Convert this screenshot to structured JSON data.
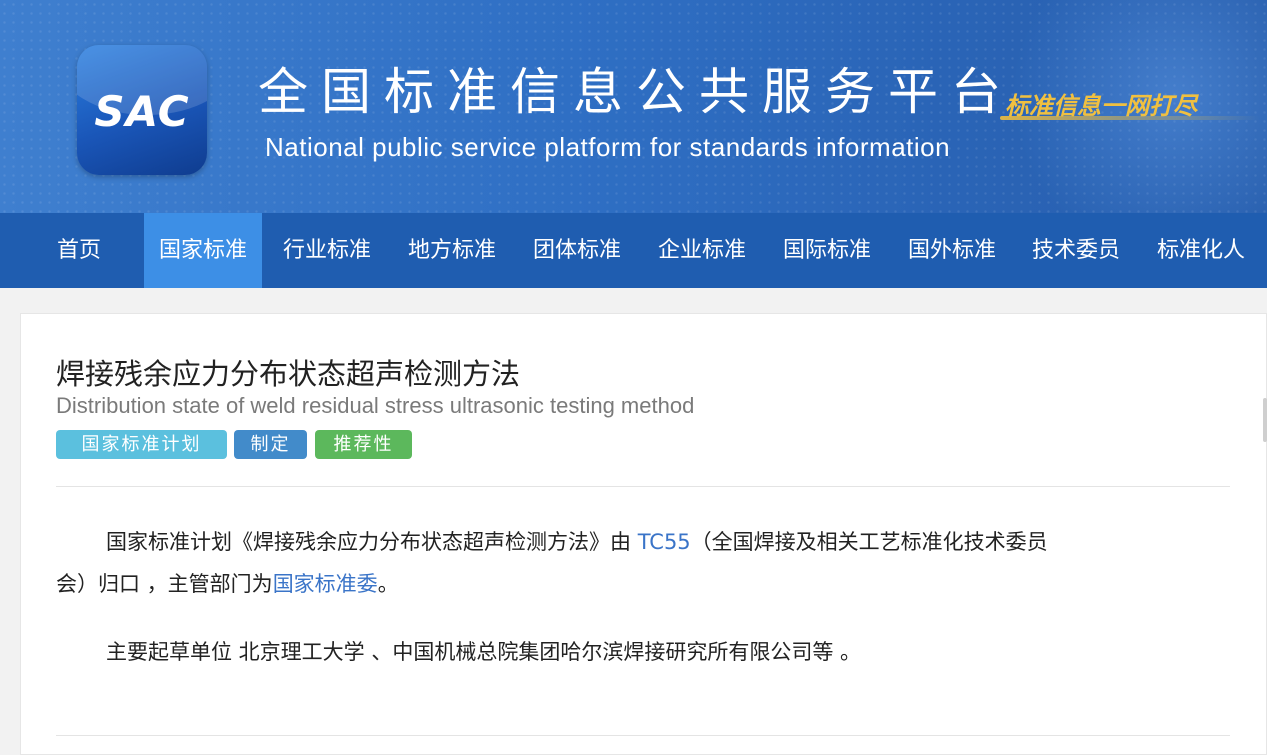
{
  "header": {
    "logo_text": "SAC",
    "title_cn": "全国标准信息公共服务平台",
    "title_en": "National public service platform  for standards information",
    "slogan": "标准信息一网打尽"
  },
  "nav": {
    "items": [
      {
        "label": "首页"
      },
      {
        "label": "国家标准"
      },
      {
        "label": "行业标准"
      },
      {
        "label": "地方标准"
      },
      {
        "label": "团体标准"
      },
      {
        "label": "企业标准"
      },
      {
        "label": "国际标准"
      },
      {
        "label": "国外标准"
      },
      {
        "label": "技术委员"
      },
      {
        "label": "标准化人"
      }
    ],
    "active_index": 1
  },
  "standard": {
    "title": "焊接残余应力分布状态超声检测方法",
    "title_en": "Distribution state of weld residual stress ultrasonic testing method",
    "tags": [
      {
        "label": "国家标准计划",
        "color": "#5bc0de"
      },
      {
        "label": "制定",
        "color": "#428bca"
      },
      {
        "label": "推荐性",
        "color": "#5cb85c"
      }
    ]
  },
  "description": {
    "p1_before": "国家标准计划《焊接残余应力分布状态超声检测方法》由 ",
    "p1_link": "TC55",
    "p1_after": "（全国焊接及相关工艺标准化技术委员",
    "p1_line2_before": "会）归口 ，主管部门为",
    "p1_line2_link": "国家标准委",
    "p1_line2_after": "。",
    "p2": "主要起草单位 北京理工大学 、中国机械总院集团哈尔滨焊接研究所有限公司等 。"
  },
  "colors": {
    "header_blue": "#2f6fc4",
    "nav_blue": "#1f5db0",
    "nav_active": "#3d8fe6",
    "link": "#3a74c8"
  }
}
